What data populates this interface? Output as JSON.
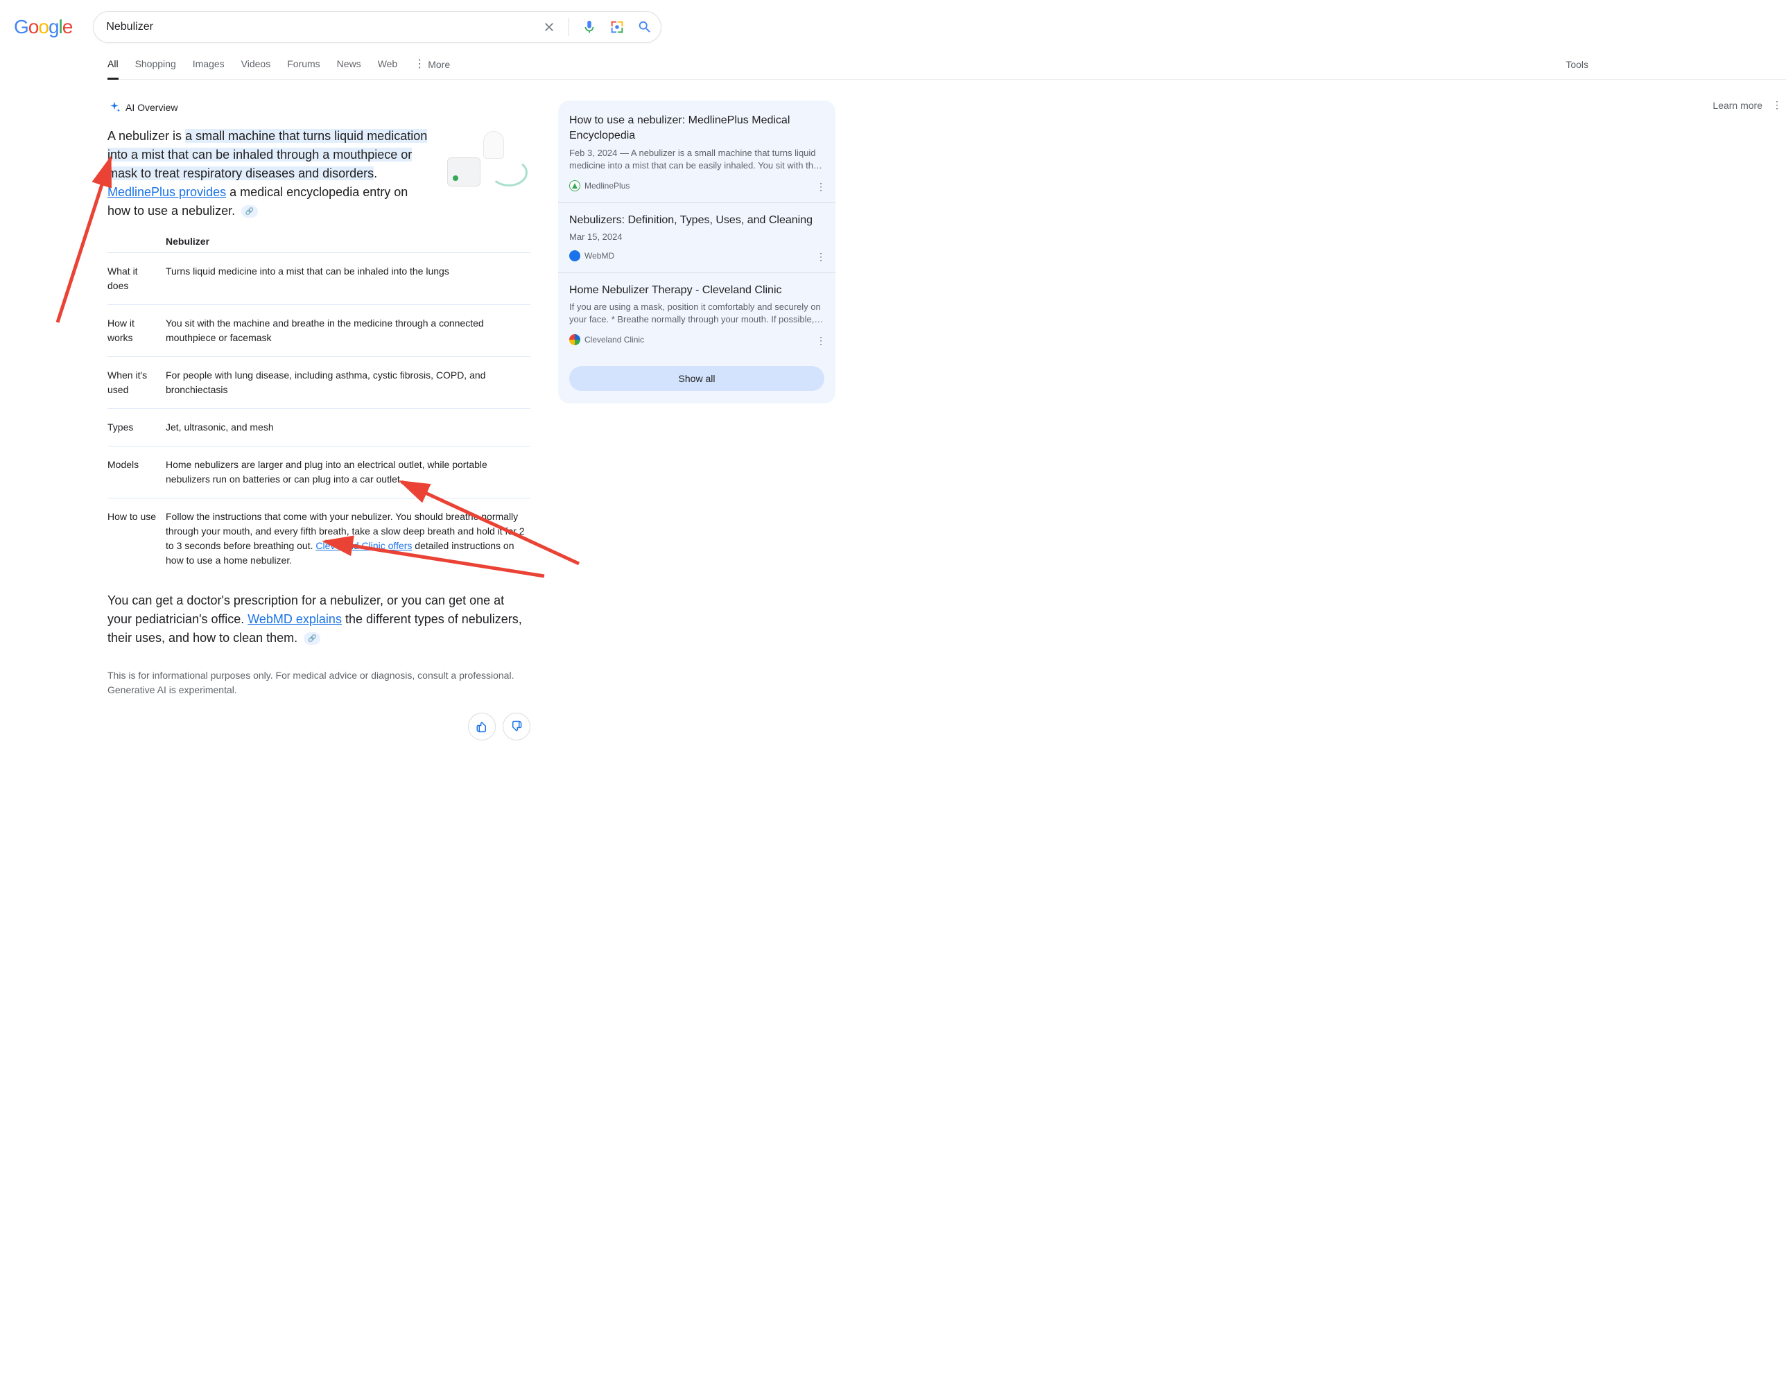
{
  "logo_text": "Google",
  "search": {
    "value": "Nebulizer"
  },
  "tabs": [
    "All",
    "Shopping",
    "Images",
    "Videos",
    "Forums",
    "News",
    "Web",
    "More"
  ],
  "tools_label": "Tools",
  "ai": {
    "label": "AI Overview",
    "learn_more": "Learn more",
    "p1_pre": "A nebulizer is ",
    "p1_hl": "a small machine that turns liquid medication into a mist that can be inhaled through a mouthpiece or mask to treat respiratory diseases and disorders",
    "p1_dot": ". ",
    "p1_link1": "MedlinePlus provides",
    "p1_post": " a medical encyclopedia entry on how to use a nebulizer.",
    "table_title": "Nebulizer",
    "rows": [
      {
        "k": "What it does",
        "v": "Turns liquid medicine into a mist that can be inhaled into the lungs"
      },
      {
        "k": "How it works",
        "v": "You sit with the machine and breathe in the medicine through a connected mouthpiece or facemask"
      },
      {
        "k": "When it's used",
        "v": "For people with lung disease, including asthma, cystic fibrosis, COPD, and bronchiectasis"
      },
      {
        "k": "Types",
        "v": "Jet, ultrasonic, and mesh"
      },
      {
        "k": "Models",
        "v": "Home nebulizers are larger and plug into an electrical outlet, while portable nebulizers run on batteries or can plug into a car outlet"
      }
    ],
    "row6": {
      "k": "How to use",
      "pre": "Follow the instructions that come with your nebulizer. You should breathe normally through your mouth, and every fifth breath, take a slow deep breath and hold it for 2 to 3 seconds before breathing out. ",
      "link": "Cleveland Clinic offers",
      "post": " detailed instructions on how to use a home nebulizer."
    },
    "p2_pre": "You can get a doctor's prescription for a nebulizer, or you can get one at your pediatrician's office. ",
    "p2_link": "WebMD explains",
    "p2_post": " the different types of nebulizers, their uses, and how to clean them.",
    "disclaimer": "This is for informational purposes only. For medical advice or diagnosis, consult a professional. Generative AI is experimental."
  },
  "sources": [
    {
      "title": "How to use a nebulizer: MedlinePlus Medical Encyclopedia",
      "date_desc": "Feb 3, 2024 — A nebulizer is a small machine that turns liquid medicine into a mist that can be easily inhaled. You sit with th…",
      "site": "MedlinePlus",
      "fav_color": "#34A853"
    },
    {
      "title": "Nebulizers: Definition, Types, Uses, and Cleaning",
      "date_desc": "Mar 15, 2024",
      "site": "WebMD",
      "fav_color": "#1a73e8"
    },
    {
      "title": "Home Nebulizer Therapy - Cleveland Clinic",
      "date_desc": "If you are using a mask, position it comfortably and securely on your face. * Breathe normally through your mouth. If possible,…",
      "site": "Cleveland Clinic",
      "fav_color": "#1967d2"
    }
  ],
  "show_all": "Show all"
}
